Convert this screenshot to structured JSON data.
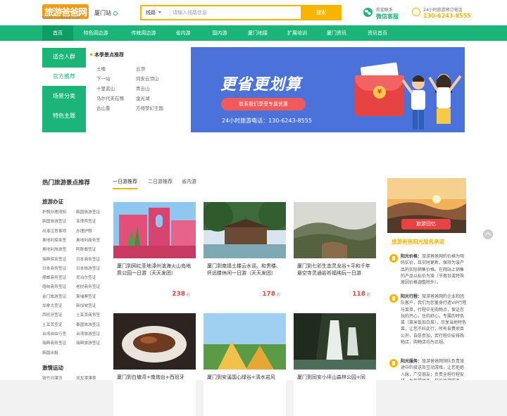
{
  "header": {
    "logo_text": "旅游爸爸网",
    "logo_url_text": "WWW.TRIPBABA.COM",
    "city": "厦门站",
    "search": {
      "select": "线路",
      "placeholder": "请输入线路信息",
      "button": "搜索"
    },
    "wechat": {
      "line1": "欢迎联系",
      "line2": "微信客服"
    },
    "hotline": {
      "line1": "24小时旅游预订电话",
      "line2": "130-6243-8555"
    }
  },
  "nav": {
    "items": [
      "首页",
      "特色周边游",
      "传统周边游",
      "省内游",
      "国内游",
      "厦门地接",
      "扩展培训",
      "厦门资讯",
      "资讯首页"
    ]
  },
  "categories": [
    "适合人群",
    "官方推荐",
    "场景分类",
    "特色主题"
  ],
  "sub_menu": {
    "title": "本季景点推荐",
    "links": [
      "土楼",
      "云顶",
      "下一站",
      "同安云顶山",
      "十里蓝山",
      "青云山",
      "马尔代夫在哪",
      "金光湖",
      "古山重",
      "方特梦幻王国"
    ]
  },
  "banner": {
    "headline": "更省更划算",
    "button": "联系我们享受专属优惠",
    "tel": "24小时旅游电话：130-6243-8555",
    "coin": "¥"
  },
  "sidebar": {
    "title": "热门旅游景点推荐",
    "sections": [
      {
        "heading": "旅游办证",
        "links": [
          "护照办理须知",
          "韩国旅游签证",
          "韩国旅游签证",
          "菲律宾签证",
          "出港注意事项",
          "办理护照",
          "奥地利探亲签",
          "奥地利商务签",
          "奥地利旅游签",
          "阿联酋签证",
          "瑞典探亲签证",
          "日本商务签证",
          "日本商务签证",
          "日本旅游签证",
          "挪威商务签证",
          "尼泊尔签证",
          "缅甸商务签证",
          "老挝商务签证",
          "金门旅游签证",
          "柬埔寨签证",
          "加拿大签证",
          "新加坡签证",
          "西班牙签证",
          "土耳其商务签",
          "土耳其签证",
          "泰国旅游签证",
          "台湾自由行签",
          "台湾旅游签证",
          "瑞典商务签证",
          "瑞典旅游签证",
          "韩国出租"
        ]
      },
      {
        "heading": "激情运动",
        "links": [
          "钱竹河漂流",
          "双龙潭漂草"
        ]
      }
    ]
  },
  "tabs": [
    "一日游推荐",
    "二日游推荐",
    "省内游"
  ],
  "tours": [
    {
      "name": "厦门到网红圣地漳州滨海火山岛地质公园一日游（天天发团）",
      "price": "238"
    },
    {
      "name": "厦门到南靖土楼云水谣、和贵楼、怀远楼休闲一日游（天天发团）",
      "price": "178"
    },
    {
      "name": "厦门到七彩生态灵龙谷+平和千年悬空寺灵通岩祈福纯玩一日游",
      "price": "118"
    },
    {
      "name": "厦门到白塘湾+南炮台+西班牙",
      "price": ""
    },
    {
      "name": "厦门到安溪国心绿谷+清水岩风",
      "price": ""
    },
    {
      "name": "厦门到同安小坪山森林公园+同",
      "price": ""
    }
  ],
  "price_unit": "起",
  "right": {
    "photo_button": "旅游回忆",
    "heading": "旅游爸爸阳光服务承诺",
    "items": [
      {
        "title": "阳光价格：",
        "text": "旅游爸爸网的价格为明码实价，且实时更新，保持为该产品的实际销售价格。在网站上销售的产品以标价为准（节假日或特殊原因价格调整除外）。"
      },
      {
        "title": "阳光行程：",
        "text": "旅游爸爸网的企业和团队客户，我们为您量身打造VIP行程与菜单，行程中无购物点，保证您玩的开心，住的舒心，专属的特色菜（菜米饭加白菜），尽享当地特色菜，让您不枉此行，所有自费项目公开，自愿参加，若行程中安排购物店，购物店均为正规。"
      },
      {
        "title": "阳光服务：",
        "text": "旅游爸爸网领队负责旅途中的接送及互动游戏，让您拒绝人脉，广交朋友；负责全程行程安排，为您提供不一样的旅游服务，在游玩过程中，全程陪同。"
      }
    ]
  },
  "colors": {
    "primary": "#1bb57a",
    "accent": "#f7b500",
    "price": "#e84343",
    "banner": "#4a72d8"
  }
}
